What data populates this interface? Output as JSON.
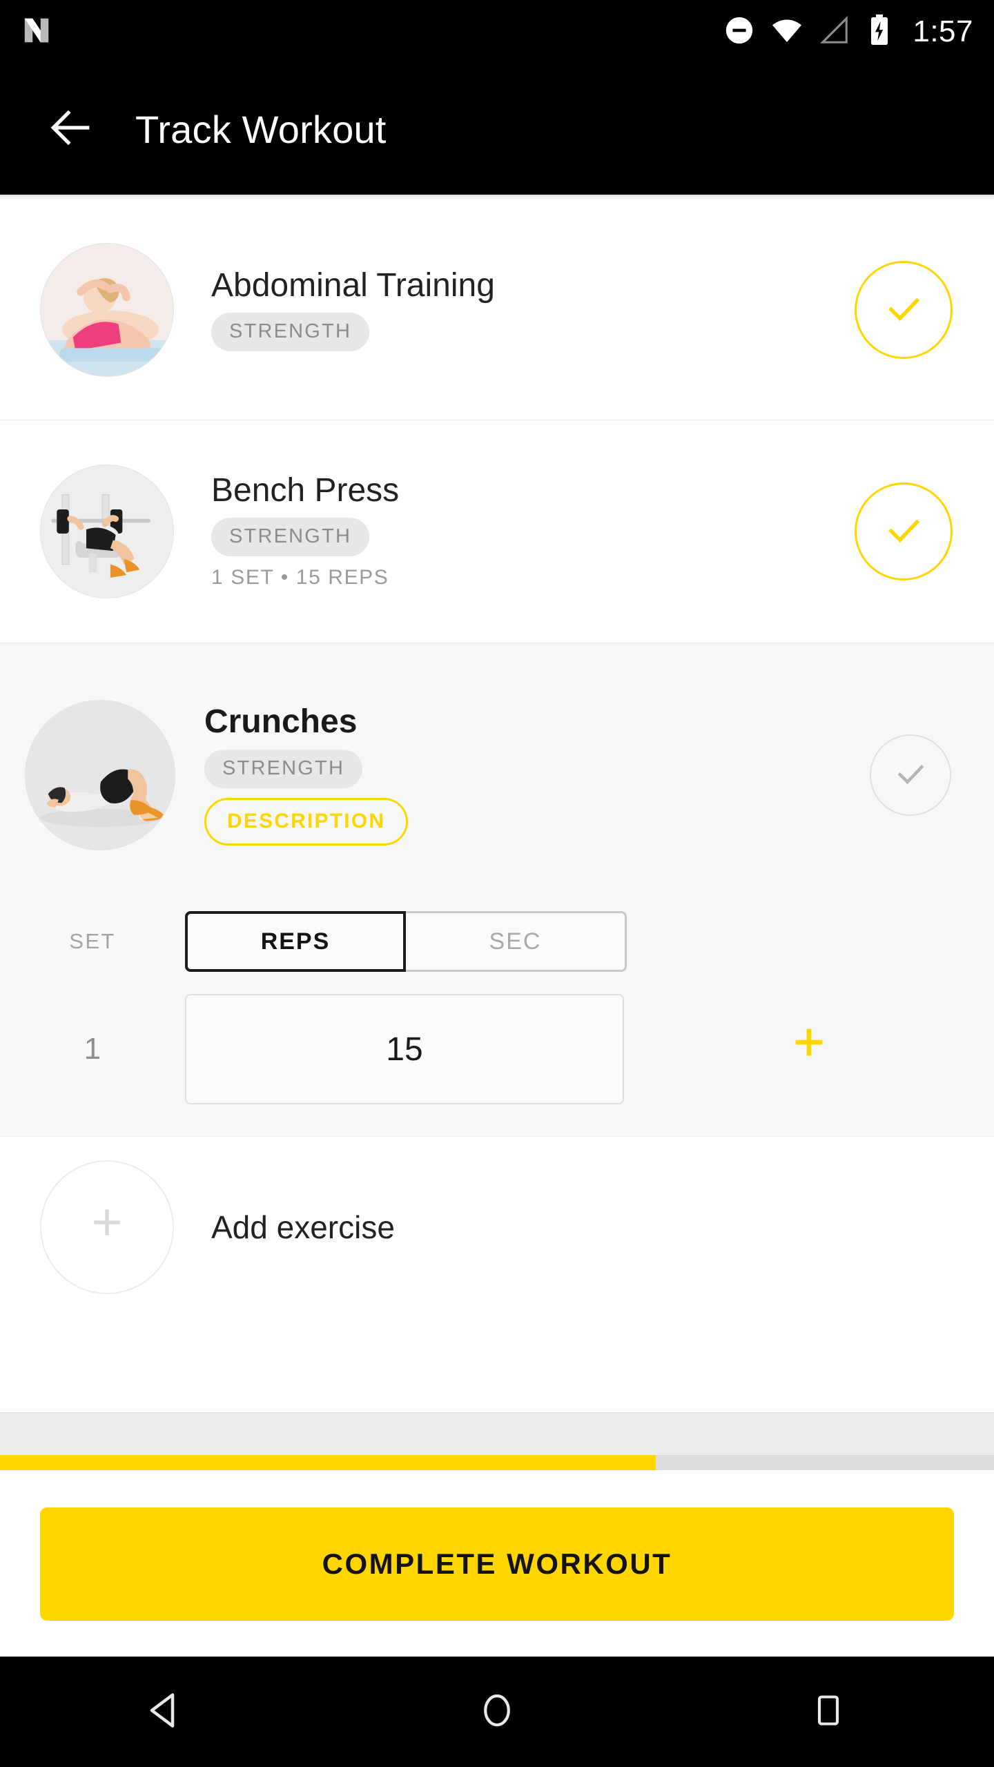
{
  "statusbar": {
    "time": "1:57",
    "icons": [
      "app-logo-icon",
      "do-not-disturb-icon",
      "wifi-icon",
      "cellular-signal-icon",
      "battery-charging-icon"
    ]
  },
  "appbar": {
    "back_icon": "arrow-back-icon",
    "title": "Track Workout"
  },
  "exercises": [
    {
      "name": "Abdominal Training",
      "category": "STRENGTH",
      "meta": "",
      "completed": true,
      "expanded": false
    },
    {
      "name": "Bench Press",
      "category": "STRENGTH",
      "meta": "1 SET • 15 REPS",
      "completed": true,
      "expanded": false
    },
    {
      "name": "Crunches",
      "category": "STRENGTH",
      "description_label": "DESCRIPTION",
      "completed": false,
      "expanded": true,
      "set_table": {
        "col_set": "SET",
        "unit_reps": "REPS",
        "unit_sec": "SEC",
        "selected_unit": "REPS",
        "rows": [
          {
            "set": "1",
            "value": "15"
          }
        ],
        "add_set_icon": "plus-icon"
      }
    }
  ],
  "add_exercise": {
    "icon": "plus-icon",
    "label": "Add exercise"
  },
  "progress": {
    "percent": 66
  },
  "cta": {
    "label": "COMPLETE WORKOUT"
  },
  "navbar": {
    "back": "nav-back-icon",
    "home": "nav-home-icon",
    "recents": "nav-recents-icon"
  },
  "colors": {
    "accent": "#FFD600",
    "bar": "#000000",
    "card_bg": "#F8F8F8",
    "pill_bg": "#E7E7E7",
    "progress_track": "#DCDCDC"
  }
}
